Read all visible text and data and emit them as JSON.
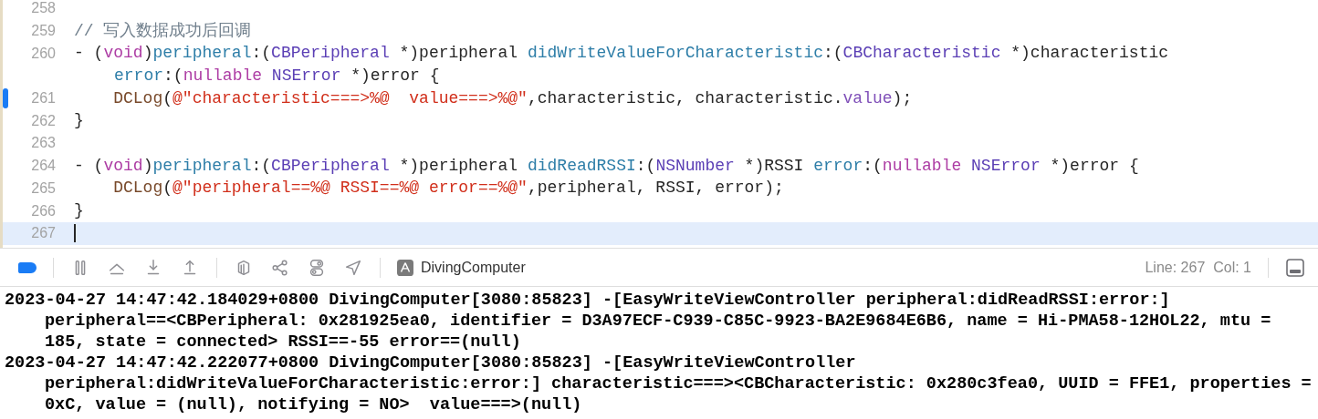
{
  "editor": {
    "lines": [
      {
        "number": "258",
        "breakpoint": false,
        "current": false
      },
      {
        "number": "259",
        "breakpoint": false,
        "current": false,
        "segments": [
          {
            "kind": "comment",
            "text": "// 写入数据成功后回调"
          }
        ]
      },
      {
        "number": "260",
        "breakpoint": false,
        "current": false,
        "segments": [
          {
            "kind": "plain",
            "text": "- ("
          },
          {
            "kind": "keyword",
            "text": "void"
          },
          {
            "kind": "plain",
            "text": ")"
          },
          {
            "kind": "method",
            "text": "peripheral"
          },
          {
            "kind": "plain",
            "text": ":("
          },
          {
            "kind": "type",
            "text": "CBPeripheral"
          },
          {
            "kind": "plain",
            "text": " *)peripheral "
          },
          {
            "kind": "method",
            "text": "didWriteValueForCharacteristic"
          },
          {
            "kind": "plain",
            "text": ":("
          },
          {
            "kind": "type",
            "text": "CBCharacteristic"
          },
          {
            "kind": "plain",
            "text": " *)characteristic"
          }
        ],
        "wrapped": [
          {
            "kind": "method",
            "text": "error"
          },
          {
            "kind": "plain",
            "text": ":("
          },
          {
            "kind": "keyword",
            "text": "nullable"
          },
          {
            "kind": "type",
            "text": " NSError"
          },
          {
            "kind": "plain",
            "text": " *)error {"
          }
        ]
      },
      {
        "number": "261",
        "breakpoint": true,
        "current": false,
        "segments": [
          {
            "kind": "macro",
            "text": "    DCLog"
          },
          {
            "kind": "plain",
            "text": "("
          },
          {
            "kind": "string",
            "text": "@\"characteristic===>%@  value===>%@\""
          },
          {
            "kind": "plain",
            "text": ",characteristic, characteristic."
          },
          {
            "kind": "property",
            "text": "value"
          },
          {
            "kind": "plain",
            "text": ");"
          }
        ]
      },
      {
        "number": "262",
        "breakpoint": false,
        "current": false,
        "segments": [
          {
            "kind": "plain",
            "text": "}"
          }
        ]
      },
      {
        "number": "263",
        "breakpoint": false,
        "current": false
      },
      {
        "number": "264",
        "breakpoint": false,
        "current": false,
        "segments": [
          {
            "kind": "plain",
            "text": "- ("
          },
          {
            "kind": "keyword",
            "text": "void"
          },
          {
            "kind": "plain",
            "text": ")"
          },
          {
            "kind": "method",
            "text": "peripheral"
          },
          {
            "kind": "plain",
            "text": ":("
          },
          {
            "kind": "type",
            "text": "CBPeripheral"
          },
          {
            "kind": "plain",
            "text": " *)peripheral "
          },
          {
            "kind": "method",
            "text": "didReadRSSI"
          },
          {
            "kind": "plain",
            "text": ":("
          },
          {
            "kind": "type",
            "text": "NSNumber"
          },
          {
            "kind": "plain",
            "text": " *)RSSI "
          },
          {
            "kind": "method",
            "text": "error"
          },
          {
            "kind": "plain",
            "text": ":("
          },
          {
            "kind": "keyword",
            "text": "nullable"
          },
          {
            "kind": "type",
            "text": " NSError"
          },
          {
            "kind": "plain",
            "text": " *)error {"
          }
        ]
      },
      {
        "number": "265",
        "breakpoint": false,
        "current": false,
        "segments": [
          {
            "kind": "macro",
            "text": "    DCLog"
          },
          {
            "kind": "plain",
            "text": "("
          },
          {
            "kind": "string",
            "text": "@\"peripheral==%@ RSSI==%@ error==%@\""
          },
          {
            "kind": "plain",
            "text": ",peripheral, RSSI, error);"
          }
        ]
      },
      {
        "number": "266",
        "breakpoint": false,
        "current": false,
        "segments": [
          {
            "kind": "plain",
            "text": "}"
          }
        ]
      },
      {
        "number": "267",
        "breakpoint": false,
        "current": true
      }
    ]
  },
  "debug_bar": {
    "breakpoints_active": true,
    "target": "DivingComputer",
    "position": "Line: 267  Col: 1"
  },
  "console": {
    "entries": [
      {
        "lines": [
          "2023-04-27 14:47:42.184029+0800 DivingComputer[3080:85823] -[EasyWriteViewController peripheral:didReadRSSI:error:]",
          "peripheral==<CBPeripheral: 0x281925ea0, identifier = D3A97ECF-C939-C85C-9923-BA2E9684E6B6, name = Hi-PMA58-12HOL22, mtu =",
          "185, state = connected> RSSI==-55 error==(null)"
        ]
      },
      {
        "lines": [
          "2023-04-27 14:47:42.222077+0800 DivingComputer[3080:85823] -[EasyWriteViewController",
          "peripheral:didWriteValueForCharacteristic:error:] characteristic===><CBCharacteristic: 0x280c3fea0, UUID = FFE1, properties =",
          "0xC, value = (null), notifying = NO>  value===>(null)"
        ]
      }
    ]
  }
}
